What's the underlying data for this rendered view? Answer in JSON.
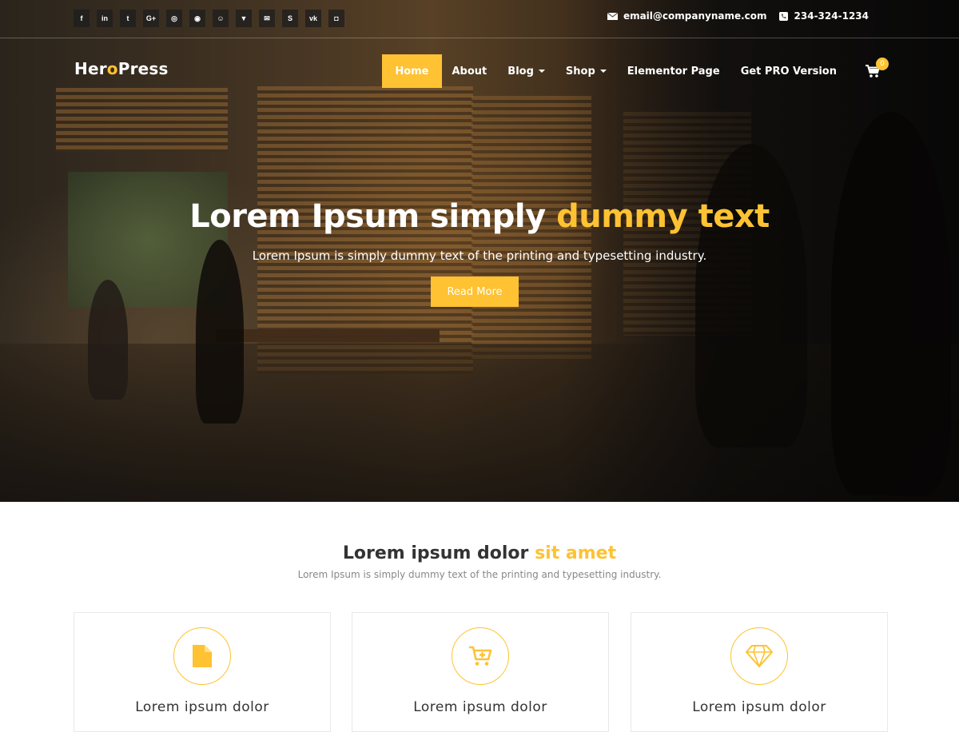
{
  "topbar": {
    "social_icons": [
      {
        "name": "facebook-icon",
        "glyph": "f"
      },
      {
        "name": "linkedin-icon",
        "glyph": "in"
      },
      {
        "name": "twitter-icon",
        "glyph": "t"
      },
      {
        "name": "google-plus-icon",
        "glyph": "G+"
      },
      {
        "name": "instagram-icon",
        "glyph": "◎"
      },
      {
        "name": "dribbble-icon",
        "glyph": "◉"
      },
      {
        "name": "github-icon",
        "glyph": "☺"
      },
      {
        "name": "foursquare-icon",
        "glyph": "▼"
      },
      {
        "name": "email-icon",
        "glyph": "✉"
      },
      {
        "name": "skype-icon",
        "glyph": "S"
      },
      {
        "name": "vk-icon",
        "glyph": "vk"
      },
      {
        "name": "yelp-icon",
        "glyph": "◘"
      }
    ],
    "email": "email@companyname.com",
    "phone": "234-324-1234"
  },
  "header": {
    "logo": {
      "part1": "Her",
      "part2": "o",
      "part3": "Press"
    },
    "nav": {
      "home": "Home",
      "about": "About",
      "blog": "Blog",
      "shop": "Shop",
      "elementor": "Elementor Page",
      "pro": "Get PRO Version"
    },
    "cart_count": "0"
  },
  "hero": {
    "title_main": "Lorem Ipsum simply ",
    "title_accent": "dummy text",
    "subtitle": "Lorem Ipsum is simply dummy text of the printing and typesetting industry.",
    "button": "Read More"
  },
  "section": {
    "title_main": "Lorem ipsum dolor ",
    "title_accent": "sit amet",
    "subtitle": "Lorem Ipsum is simply dummy text of the printing and typesetting industry.",
    "cards": [
      {
        "icon": "document-icon",
        "title": "Lorem ipsum dolor"
      },
      {
        "icon": "cart-plus-icon",
        "title": "Lorem ipsum dolor"
      },
      {
        "icon": "diamond-icon",
        "title": "Lorem ipsum dolor"
      }
    ]
  },
  "colors": {
    "accent": "#fec233",
    "text": "#333333",
    "muted": "#888888"
  }
}
